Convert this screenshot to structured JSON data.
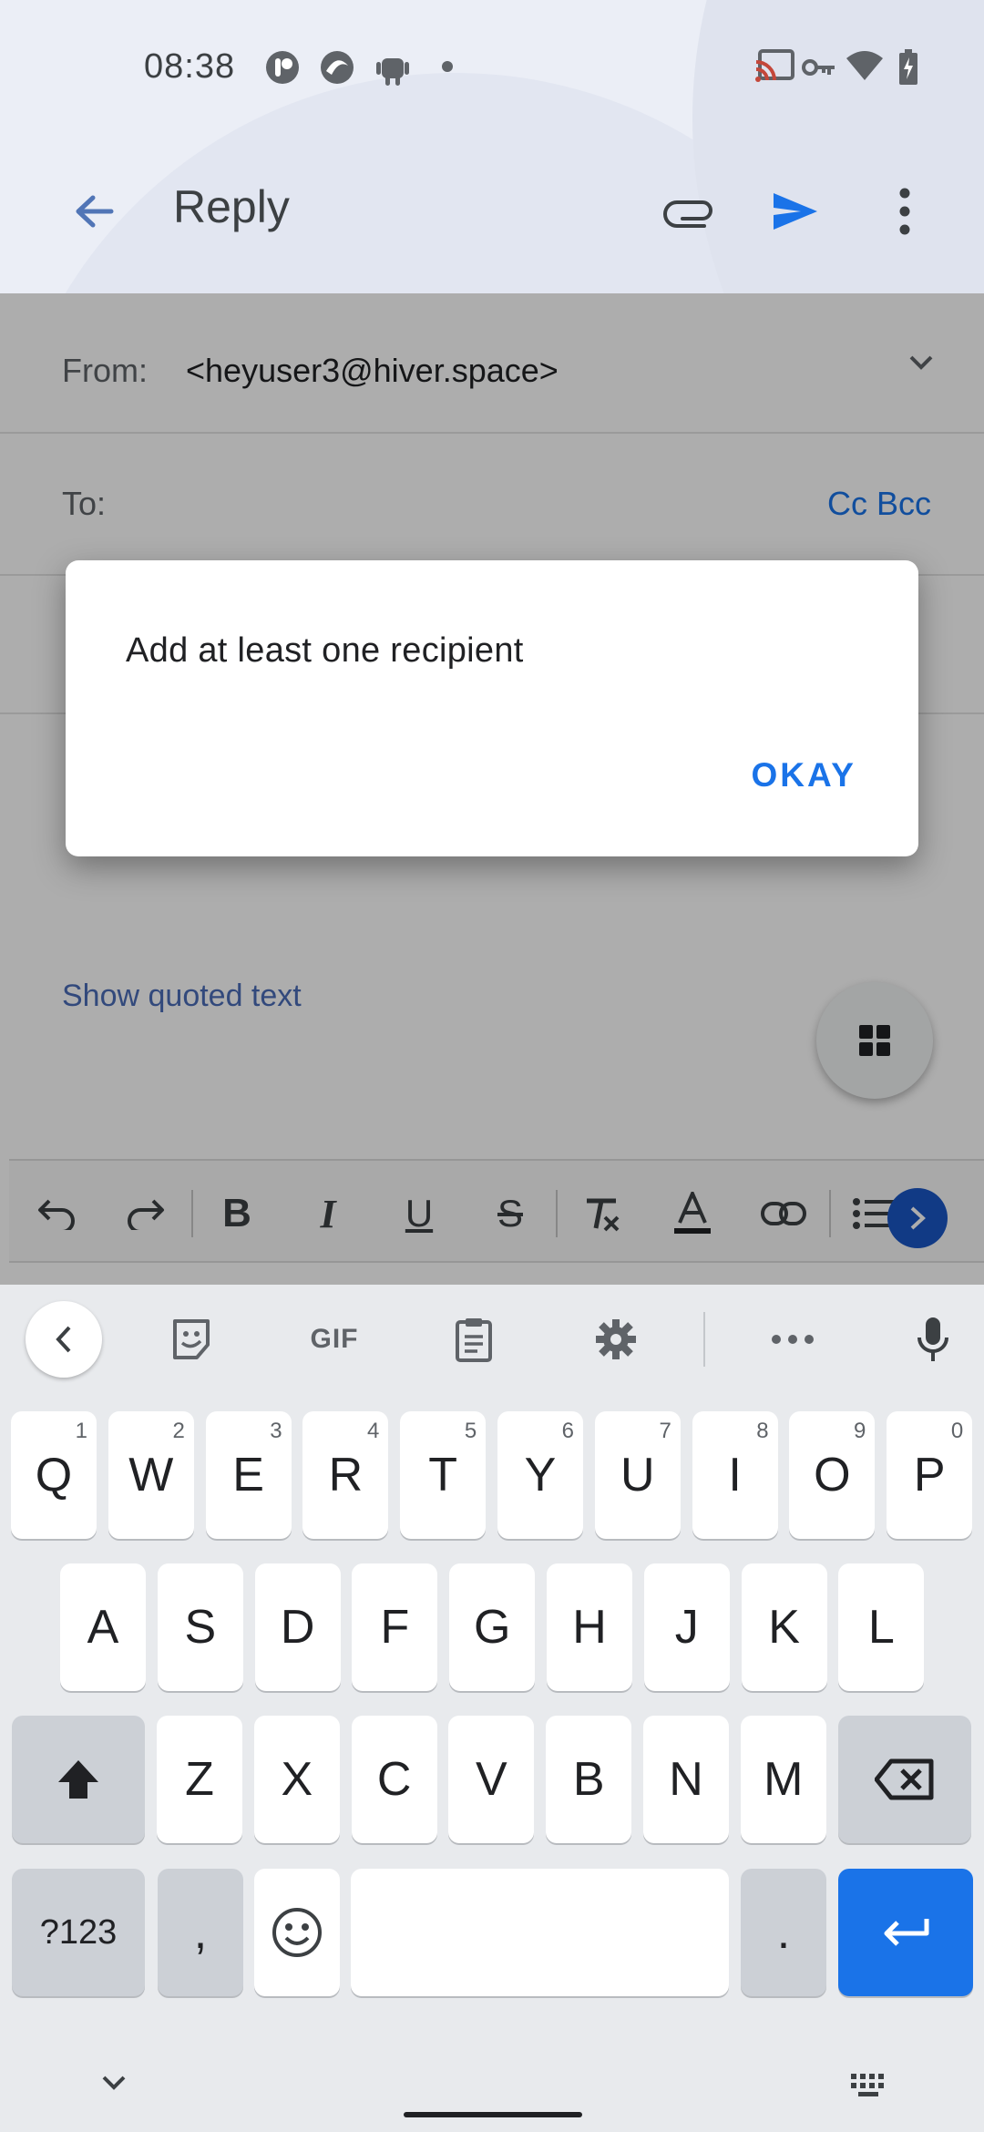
{
  "status_bar": {
    "time": "08:38"
  },
  "app_bar": {
    "title": "Reply"
  },
  "compose": {
    "from_label": "From:",
    "from_value": "<heyuser3@hiver.space>",
    "to_label": "To:",
    "cc_bcc": "Cc Bcc",
    "show_quoted": "Show quoted text"
  },
  "dialog": {
    "message": "Add at least one recipient",
    "ok_label": "OKAY"
  },
  "keyboard": {
    "suggestions": [
      "GIF"
    ],
    "row1": [
      {
        "key": "Q",
        "hint": "1"
      },
      {
        "key": "W",
        "hint": "2"
      },
      {
        "key": "E",
        "hint": "3"
      },
      {
        "key": "R",
        "hint": "4"
      },
      {
        "key": "T",
        "hint": "5"
      },
      {
        "key": "Y",
        "hint": "6"
      },
      {
        "key": "U",
        "hint": "7"
      },
      {
        "key": "I",
        "hint": "8"
      },
      {
        "key": "O",
        "hint": "9"
      },
      {
        "key": "P",
        "hint": "0"
      }
    ],
    "row2": [
      "A",
      "S",
      "D",
      "F",
      "G",
      "H",
      "J",
      "K",
      "L"
    ],
    "row3": [
      "Z",
      "X",
      "C",
      "V",
      "B",
      "N",
      "M"
    ],
    "symbols_label": "?123",
    "comma_label": ",",
    "period_label": "."
  },
  "colors": {
    "accent": "#1a73e8",
    "appbar_bg": "#ebeef6",
    "keyboard_bg": "#e8eaed"
  }
}
